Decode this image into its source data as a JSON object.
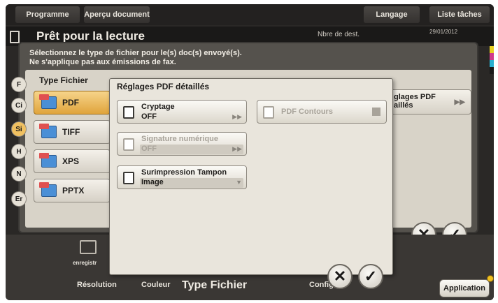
{
  "topbar": {
    "programme": "Programme",
    "apercu": "Aperçu document",
    "langage": "Langage",
    "liste": "Liste tâches"
  },
  "status": {
    "title": "Prêt pour la lecture",
    "nb_dest": "Nbre de dest.",
    "date": "29/01/2012"
  },
  "outer_dialog": {
    "line1": "Sélectionnez le type de fichier pour le(s) doc(s) envoyé(s).",
    "line2": "Ne s'applique pas aux émissions de fax.",
    "list_title": "Type Fichier",
    "file_types": [
      "PDF",
      "TIFF",
      "XPS",
      "PPTX"
    ],
    "selected_type": "PDF",
    "edge_tabs": [
      "F",
      "Ci",
      "Si",
      "H",
      "N",
      "Er"
    ],
    "behind_button_line1": "glages PDF",
    "behind_button_line2": "aillés"
  },
  "inner_dialog": {
    "title": "Réglages PDF détaillés",
    "cryptage_label": "Cryptage",
    "cryptage_value": "OFF",
    "signature_label": "Signature numérique",
    "signature_value": "OFF",
    "surimpression_label": "Surimpression Tampon",
    "surimpression_value": "Image",
    "pdf_contours_label": "PDF Contours"
  },
  "bottom": {
    "resolution": "Résolution",
    "couleur": "Couleur",
    "type_fichier": "Type Fichier",
    "config": "Config",
    "application": "Application",
    "enregistr": "enregistr"
  },
  "icons": {
    "cancel": "cancel-x-icon",
    "ok": "ok-check-icon"
  }
}
